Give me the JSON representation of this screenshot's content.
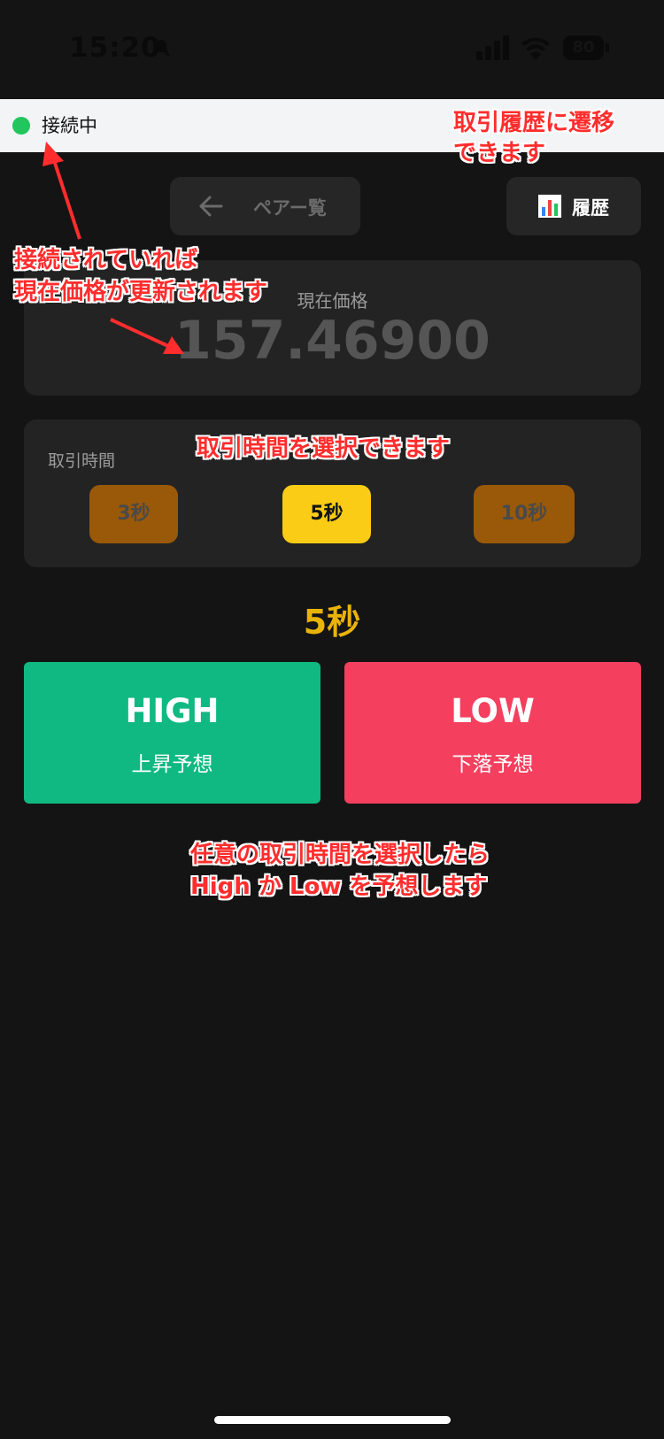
{
  "status_bar": {
    "time": "15:20",
    "battery": "80"
  },
  "connection": {
    "label": "接続中",
    "color": "#22c55e"
  },
  "nav": {
    "back_arrow": "←",
    "back_label": "ペアー覧",
    "history_icon": "bar-chart-icon",
    "history_label": "履歴"
  },
  "price": {
    "label": "現在価格",
    "value": "157.46900"
  },
  "trade_time": {
    "title": "取引時間",
    "options": [
      "3秒",
      "5秒",
      "10秒"
    ],
    "selected_index": 1,
    "selected_label": "5秒"
  },
  "actions": {
    "high": {
      "label": "HIGH",
      "sub": "上昇予想",
      "color": "#10b981"
    },
    "low": {
      "label": "LOW",
      "sub": "下落予想",
      "color": "#f43f5e"
    }
  },
  "annotations": {
    "history": "取引履歴に遷移\nできます",
    "connection": "接続されていれば\n現在価格が更新されます",
    "time": "取引時間を選択できます",
    "predict": "任意の取引時間を選択したら\nHigh か Low を予想します"
  },
  "colors": {
    "background": "#141414",
    "accent": "#eab308",
    "annotation": "#ff2d2d"
  }
}
